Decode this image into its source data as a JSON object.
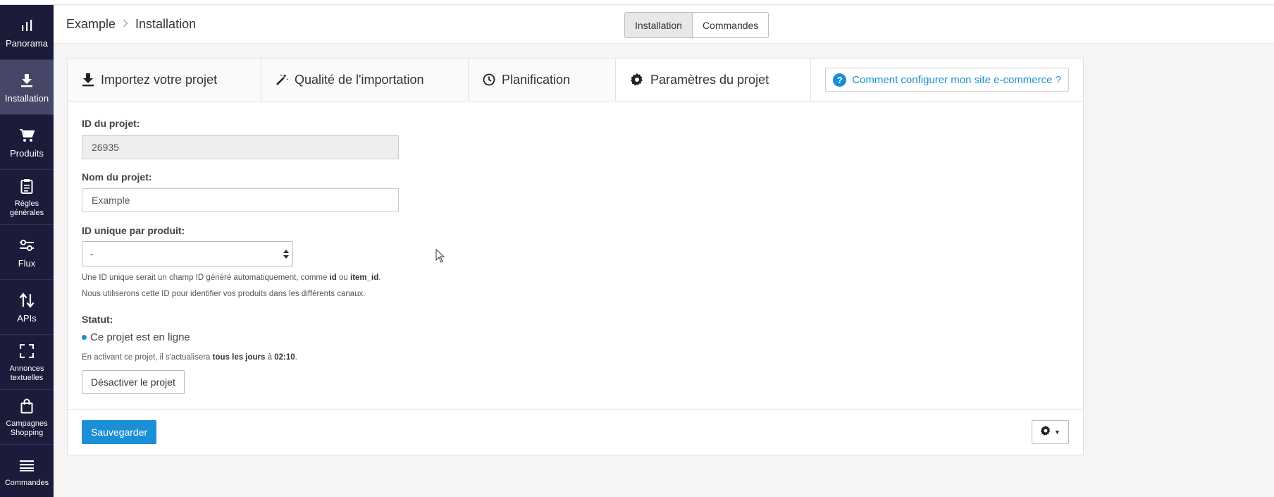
{
  "sidebar": {
    "items": [
      {
        "label": "Panorama",
        "icon": "bar-chart-icon"
      },
      {
        "label": "Installation",
        "icon": "download-icon"
      },
      {
        "label": "Produits",
        "icon": "cart-icon"
      },
      {
        "label": "Règles\ngénérales",
        "icon": "clipboard-icon"
      },
      {
        "label": "Flux",
        "icon": "sliders-icon"
      },
      {
        "label": "APIs",
        "icon": "arrows-updown-icon"
      },
      {
        "label": "Annonces\ntextuelles",
        "icon": "expand-icon"
      },
      {
        "label": "Campagnes\nShopping",
        "icon": "shopping-bag-icon"
      },
      {
        "label": "Commandes",
        "icon": "list-icon"
      }
    ]
  },
  "header": {
    "breadcrumb": [
      "Example",
      "Installation"
    ],
    "segments": [
      "Installation",
      "Commandes"
    ]
  },
  "tabs": [
    {
      "label": "Importez votre projet",
      "icon": "download-icon"
    },
    {
      "label": "Qualité de l'importation",
      "icon": "magic-wand-icon"
    },
    {
      "label": "Planification",
      "icon": "clock-icon"
    },
    {
      "label": "Paramètres du projet",
      "icon": "gear-icon"
    }
  ],
  "help_button": {
    "label": "Comment configurer mon site e-commerce ?",
    "icon": "question-circle-icon"
  },
  "form": {
    "project_id_label": "ID du projet:",
    "project_id_value": "26935",
    "project_name_label": "Nom du projet:",
    "project_name_value": "Example",
    "unique_id_label": "ID unique par produit:",
    "unique_id_value": "-",
    "help_line1_prefix": "Une ID unique serait un champ ID généré automatiquement, comme ",
    "help_line1_id": "id",
    "help_line1_or": " ou ",
    "help_line1_itemid": "item_id",
    "help_line1_end": ".",
    "help_line2": "Nous utiliserons cette ID pour identifier vos produits dans les différents canaux.",
    "status_label": "Statut:",
    "status_value": "Ce projet est en ligne",
    "status_note_prefix": "En activant ce projet, il s'actualisera ",
    "status_note_freq": "tous les jours",
    "status_note_mid": " à ",
    "status_note_time": "02:10",
    "status_note_end": ".",
    "deactivate_label": "Désactiver le projet"
  },
  "footer": {
    "save_label": "Sauvegarder"
  },
  "colors": {
    "sidebar_bg": "#1b1c3a",
    "sidebar_active": "#464766",
    "accent": "#1a8fd6"
  }
}
